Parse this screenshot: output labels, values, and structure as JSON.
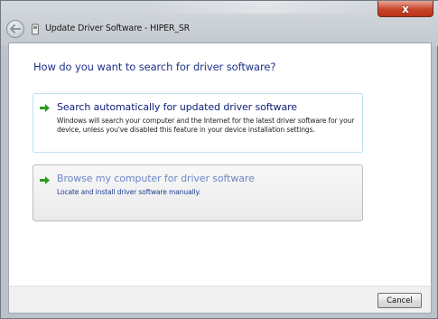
{
  "window": {
    "title": "Update Driver Software - HIPER_SR",
    "close_glyph": "x"
  },
  "main": {
    "heading": "How do you want to search for driver software?",
    "options": [
      {
        "title": "Search automatically for updated driver software",
        "description": "Windows will search your computer and the Internet for the latest driver software for your device, unless you've disabled this feature in your device installation settings.",
        "icon": "green-arrow-icon"
      },
      {
        "title": "Browse my computer for driver software",
        "description": "Locate and install driver software manually.",
        "icon": "green-arrow-icon"
      }
    ]
  },
  "footer": {
    "cancel_label": "Cancel"
  },
  "colors": {
    "heading": "#1e3287",
    "option_title": "#10207a",
    "option_title_hover": "#6b86c8",
    "arrow": "#2e9b1d",
    "close_button": "#c9442a"
  }
}
